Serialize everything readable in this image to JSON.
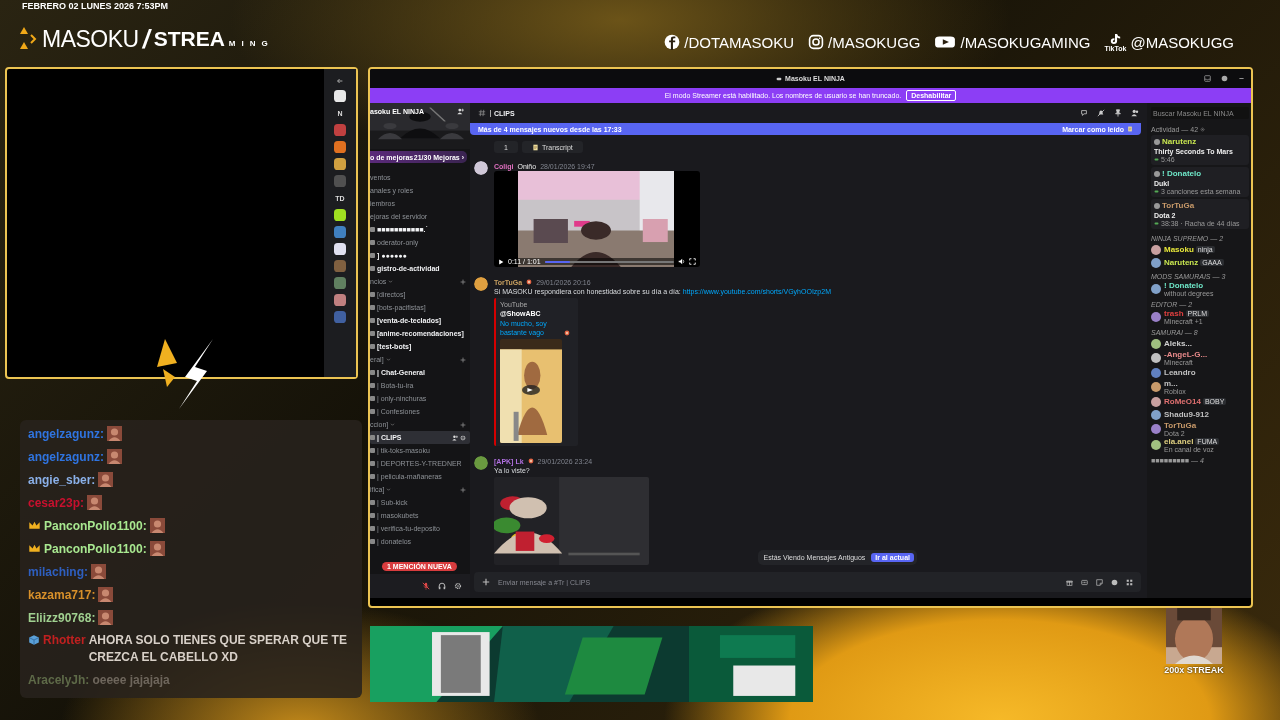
{
  "overlay": {
    "datetime": "FEBRERO 02 LUNES 2026 7:53PM",
    "logo": {
      "brand": "MASOKU",
      "slash": "/",
      "word": "STREA",
      "word_tail": "MING"
    },
    "socials": [
      {
        "kind": "facebook",
        "handle": "/DOTAMASOKU"
      },
      {
        "kind": "instagram",
        "handle": "/MASOKUGG"
      },
      {
        "kind": "youtube",
        "handle": "/MASOKUGAMING"
      },
      {
        "kind": "tiktok",
        "handle": "@MASOKUGG",
        "caption": "TikTok"
      }
    ]
  },
  "webcam": {
    "rail": [
      {
        "kind": "arrow"
      },
      {
        "kind": "avatar",
        "color": "#e8e8e8"
      },
      {
        "kind": "letter",
        "text": "N"
      },
      {
        "kind": "avatar",
        "color": "#c04040"
      },
      {
        "kind": "avatar",
        "color": "#e07020"
      },
      {
        "kind": "avatar",
        "color": "#d0a040"
      },
      {
        "kind": "avatar",
        "color": "#505050"
      },
      {
        "kind": "letter",
        "text": "TD"
      },
      {
        "kind": "avatar",
        "color": "#a0e020"
      },
      {
        "kind": "avatar",
        "color": "#4080c0"
      },
      {
        "kind": "avatar",
        "color": "#e0e0f0"
      },
      {
        "kind": "avatar",
        "color": "#806040"
      },
      {
        "kind": "avatar",
        "color": "#608060"
      },
      {
        "kind": "avatar",
        "color": "#c08080"
      },
      {
        "kind": "avatar",
        "color": "#4060a0"
      }
    ]
  },
  "chat": {
    "messages": [
      {
        "user": "angelzagunz:",
        "color": "#2f74e0",
        "badge": false,
        "kind": "emote",
        "faded": false
      },
      {
        "user": "angelzagunz:",
        "color": "#2f74e0",
        "badge": false,
        "kind": "emote",
        "faded": false
      },
      {
        "user": "angie_sber:",
        "color": "#8ab0e8",
        "badge": false,
        "kind": "emote",
        "faded": false
      },
      {
        "user": "cesar23p:",
        "color": "#c8102e",
        "badge": false,
        "kind": "emote",
        "faded": false
      },
      {
        "user": "PanconPollo1100:",
        "color": "#a8e890",
        "badge": true,
        "kind": "emote",
        "faded": false
      },
      {
        "user": "PanconPollo1100:",
        "color": "#a8e890",
        "badge": true,
        "kind": "emote",
        "faded": false
      },
      {
        "user": "milaching:",
        "color": "#2e5fc0",
        "badge": false,
        "kind": "emote",
        "faded": false
      },
      {
        "user": "kazama717:",
        "color": "#d8902a",
        "badge": false,
        "kind": "emote",
        "faded": false
      },
      {
        "user": "Eliizz90768:",
        "color": "#a0d090",
        "badge": false,
        "kind": "emote",
        "faded": false
      },
      {
        "user": "Rhotter",
        "color": "#c02020",
        "badge": true,
        "kind": "text",
        "text": "AHORA SOLO TIENES QUE SPERAR QUE TE CREZCA EL CABELLO XD",
        "faded": false
      },
      {
        "user": "AracelyJh:",
        "color": "#5e6a48",
        "badge": false,
        "kind": "text",
        "text": "oeeee jajajaja",
        "faded": true
      }
    ]
  },
  "discord": {
    "window_title": "Masoku EL NINJA",
    "streamer_banner": {
      "text": "El modo Streamer está habilitado. Los nombres de usuario se han truncado.",
      "button": "Deshabilitar"
    },
    "server": {
      "name": "asoku EL NINJA",
      "boost_label": "o de mejoras",
      "boost_count": "21/30 Mejoras ›"
    },
    "sidebar_items": [
      {
        "kind": "nav",
        "text": "ventos",
        "unread": false,
        "selected": false
      },
      {
        "kind": "nav",
        "text": "anales y roles",
        "unread": false,
        "selected": false
      },
      {
        "kind": "nav",
        "text": "iembros",
        "unread": false,
        "selected": false
      },
      {
        "kind": "nav",
        "text": "ejoras del servidor",
        "unread": false,
        "selected": false
      },
      {
        "kind": "channel",
        "text": "■■■■■■■■■■■.˙",
        "unread": true,
        "selected": false
      },
      {
        "kind": "channel",
        "text": "oderator-only",
        "unread": false,
        "selected": false
      },
      {
        "kind": "channel",
        "text": "] ●●●●●●",
        "unread": true,
        "selected": false
      },
      {
        "kind": "channel",
        "text": "gistro-de-actividad",
        "unread": true,
        "selected": false
      },
      {
        "kind": "category",
        "text": "ncios",
        "unread": false,
        "selected": false
      },
      {
        "kind": "channel",
        "text": "[directos]",
        "unread": false,
        "selected": false
      },
      {
        "kind": "channel",
        "text": "[bots-pacifistas]",
        "unread": false,
        "selected": false
      },
      {
        "kind": "channel",
        "text": "[venta-de-teclados]",
        "unread": true,
        "selected": false
      },
      {
        "kind": "channel",
        "text": "[anime-recomendaciones]",
        "unread": true,
        "selected": false
      },
      {
        "kind": "channel",
        "text": "[test-bots]",
        "unread": true,
        "selected": false
      },
      {
        "kind": "category",
        "text": "eral]",
        "unread": false,
        "selected": false
      },
      {
        "kind": "channel",
        "text": "| Chat-General",
        "unread": true,
        "selected": false
      },
      {
        "kind": "channel",
        "text": "| Bota-tu-ira",
        "unread": false,
        "selected": false
      },
      {
        "kind": "channel",
        "text": "| only-ninchuras",
        "unread": false,
        "selected": false
      },
      {
        "kind": "channel",
        "text": "| Confesiones",
        "unread": false,
        "selected": false
      },
      {
        "kind": "category",
        "text": "ccion]",
        "unread": false,
        "selected": false
      },
      {
        "kind": "channel",
        "text": "| CLIPS",
        "unread": true,
        "selected": true
      },
      {
        "kind": "channel",
        "text": "| tik-toks-masoku",
        "unread": false,
        "selected": false
      },
      {
        "kind": "channel",
        "text": "| DEPORTES-Y-TREDNER",
        "unread": false,
        "selected": false
      },
      {
        "kind": "channel",
        "text": "| pelicula-mañaneras",
        "unread": false,
        "selected": false
      },
      {
        "kind": "category",
        "text": "ifica]",
        "unread": false,
        "selected": false
      },
      {
        "kind": "channel",
        "text": "| Sub-kick",
        "unread": false,
        "selected": false
      },
      {
        "kind": "channel",
        "text": "| masokubets",
        "unread": false,
        "selected": false
      },
      {
        "kind": "channel",
        "text": "| verifica-tu-deposito",
        "unread": false,
        "selected": false
      },
      {
        "kind": "channel",
        "text": "| donatelos",
        "unread": false,
        "selected": false
      }
    ],
    "mention_pill": "1 MENCIÓN NUEVA",
    "channel": {
      "name": "CLIPS"
    },
    "new_messages": {
      "text": "Más de 4 mensajes nuevos desde las 17:33",
      "action": "Marcar como leído"
    },
    "top_actions": [
      "1",
      "Transcript"
    ],
    "messages": [
      {
        "kind": "video",
        "author": "Coligi",
        "color": "#e070c0",
        "badge": "Oniño",
        "time": "28/01/2026 19:47",
        "video_time": "0:11 / 1:01",
        "level": 0.2
      },
      {
        "kind": "embed",
        "author": "TorTuGa",
        "color": "#c8a060",
        "time": "29/01/2026 20:16",
        "text": "Si MASOKU respondiera con honestidad sobre su día a día:",
        "link": "https://www.youtube.com/shorts/VGyhOOIzp2M",
        "embed": {
          "provider": "YouTube",
          "channel": "@ShowABC",
          "title": "No mucho, soy bastante vago"
        }
      },
      {
        "author": "[APK] Lk",
        "color": "#b070e0",
        "time": "29/01/2026 23:24",
        "text": "Ya lo viste?"
      }
    ],
    "toast": {
      "text": "Estás Viendo Mensajes Antiguos",
      "button": "Ir al actual"
    },
    "composer": {
      "placeholder": "Enviar mensaje a #Tr | CLIPS"
    },
    "members": {
      "search_placeholder": "Buscar Masoku EL NINJA",
      "activity_title": "Actividad — 42",
      "activities": [
        {
          "name": "Narutenz",
          "color": "#c8e650",
          "title": "Thirty Seconds To Mars",
          "detail": "5:46"
        },
        {
          "name": "! Donatelo",
          "color": "#6ee7c8",
          "title": "Dukl",
          "detail": "3 canciones esta semana"
        },
        {
          "name": "TorTuGa",
          "color": "#c89a6a",
          "title": "Dota 2",
          "detail": "38:38 · Racha de 44 días"
        }
      ],
      "groups": [
        {
          "title": "NINJA SUPREMO — 2",
          "members": [
            {
              "name": "Masoku",
              "color": "#e8e83a",
              "tag": "ninja"
            },
            {
              "name": "Narutenz",
              "color": "#c8e650",
              "tag": "GAAA"
            }
          ]
        },
        {
          "title": "MODS SAMURAIS — 3",
          "members": [
            {
              "name": "! Donatelo",
              "color": "#6ee7c8",
              "sub": "without degrees"
            }
          ]
        },
        {
          "title": "EDITOR — 2",
          "members": [
            {
              "name": "trash",
              "color": "#e04040",
              "tag": "PRLM",
              "sub": "Minecraft +1"
            }
          ]
        },
        {
          "title": "SAMURAI — 8",
          "members": [
            {
              "name": "Aleks...",
              "color": "#d0d0d0"
            },
            {
              "name": "-AngeL-G...",
              "color": "#e88a8a",
              "sub": "Minecraft"
            },
            {
              "name": "Leandro",
              "color": "#c0c0c0"
            },
            {
              "name": "m...",
              "color": "#c0c0c0",
              "sub": "Roblox"
            },
            {
              "name": "RoMeO14",
              "color": "#e07070",
              "tag": "BOBY"
            },
            {
              "name": "Shadu9-912",
              "color": "#c0c0c0"
            },
            {
              "name": "TorTuGa",
              "color": "#c89a6a",
              "sub": "Dota 2"
            },
            {
              "name": "ela.anel",
              "color": "#e0d080",
              "tag": "FUMA",
              "sub": "En canal de voz"
            }
          ]
        },
        {
          "title": "■■■■■■■■■ — 4"
        }
      ]
    }
  },
  "alert": {
    "text": "200x STREAK"
  }
}
